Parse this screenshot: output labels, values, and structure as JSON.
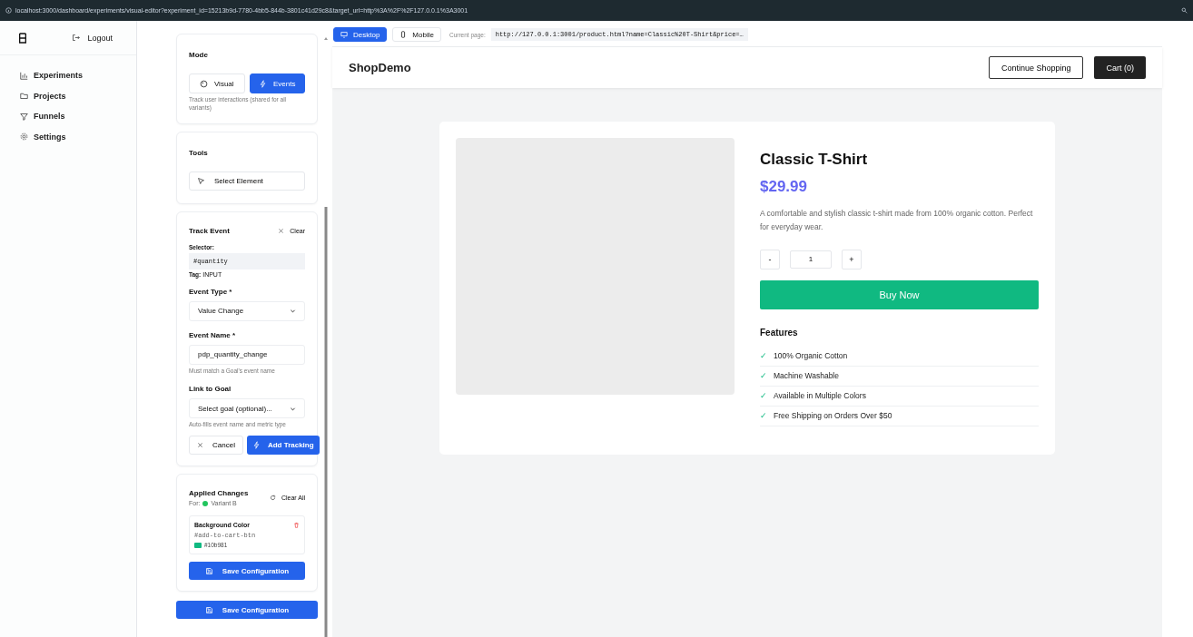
{
  "address_bar": {
    "url": "localhost:3000/dashboard/experiments/visual-editor?experiment_id=15213b9d-7780-4bb5-844b-3801c41d29c8&target_url=http%3A%2F%2F127.0.0.1%3A3001"
  },
  "sidebar": {
    "logout": "Logout",
    "items": [
      {
        "label": "Experiments",
        "selected": false
      },
      {
        "label": "Projects",
        "selected": false
      },
      {
        "label": "Funnels",
        "selected": false
      },
      {
        "label": "Settings",
        "selected": false
      }
    ]
  },
  "mode": {
    "title": "Mode",
    "options": [
      {
        "label": "Visual",
        "selected": false
      },
      {
        "label": "Events",
        "selected": true
      }
    ],
    "hint": "Track user interactions (shared for all variants)"
  },
  "tools": {
    "title": "Tools",
    "button": "Select Element"
  },
  "track_event": {
    "title": "Track Event",
    "clear": "Clear",
    "selector_label": "Selector:",
    "selector": "#quantity",
    "tag_label": "Tag:",
    "tag": "INPUT",
    "event_type": {
      "label": "Event Type *",
      "value": "Value Change"
    },
    "event_name": {
      "label": "Event Name *",
      "value": "pdp_quantity_change",
      "hint": "Must match a Goal's event name"
    },
    "goal": {
      "label": "Link to Goal",
      "value": "Select goal (optional)...",
      "hint": "Auto-fills event name and metric type"
    },
    "cancel": "Cancel",
    "add": "Add Tracking"
  },
  "applied_changes": {
    "title": "Applied Changes",
    "for_label": "For:",
    "variant": {
      "name": "Variant B",
      "color": "#22c55e"
    },
    "clear_all": "Clear All",
    "changes": [
      {
        "property": "Background Color",
        "selector": "#add-to-cart-btn",
        "color": "#10b981",
        "value": "#10b981"
      }
    ],
    "save": "Save Configuration"
  },
  "save_bottom": "Save Configuration",
  "preview": {
    "devices": [
      {
        "label": "Desktop",
        "selected": true
      },
      {
        "label": "Mobile",
        "selected": false
      }
    ],
    "current_page_label": "Current page:",
    "current_page_url": "http://127.0.0.1:3001/product.html?name=Classic%20T-Shirt&price=…"
  },
  "shop": {
    "brand": "ShopDemo",
    "continue": "Continue Shopping",
    "cart": "Cart (0)",
    "product": {
      "title": "Classic T-Shirt",
      "price": "$29.99",
      "description": "A comfortable and stylish classic t-shirt made from 100% organic cotton. Perfect for everyday wear.",
      "minus": "-",
      "quantity": "1",
      "plus": "+",
      "buy": "Buy Now",
      "features_title": "Features",
      "features": [
        "100% Organic Cotton",
        "Machine Washable",
        "Available in Multiple Colors",
        "Free Shipping on Orders Over $50"
      ],
      "check": "✓"
    }
  }
}
